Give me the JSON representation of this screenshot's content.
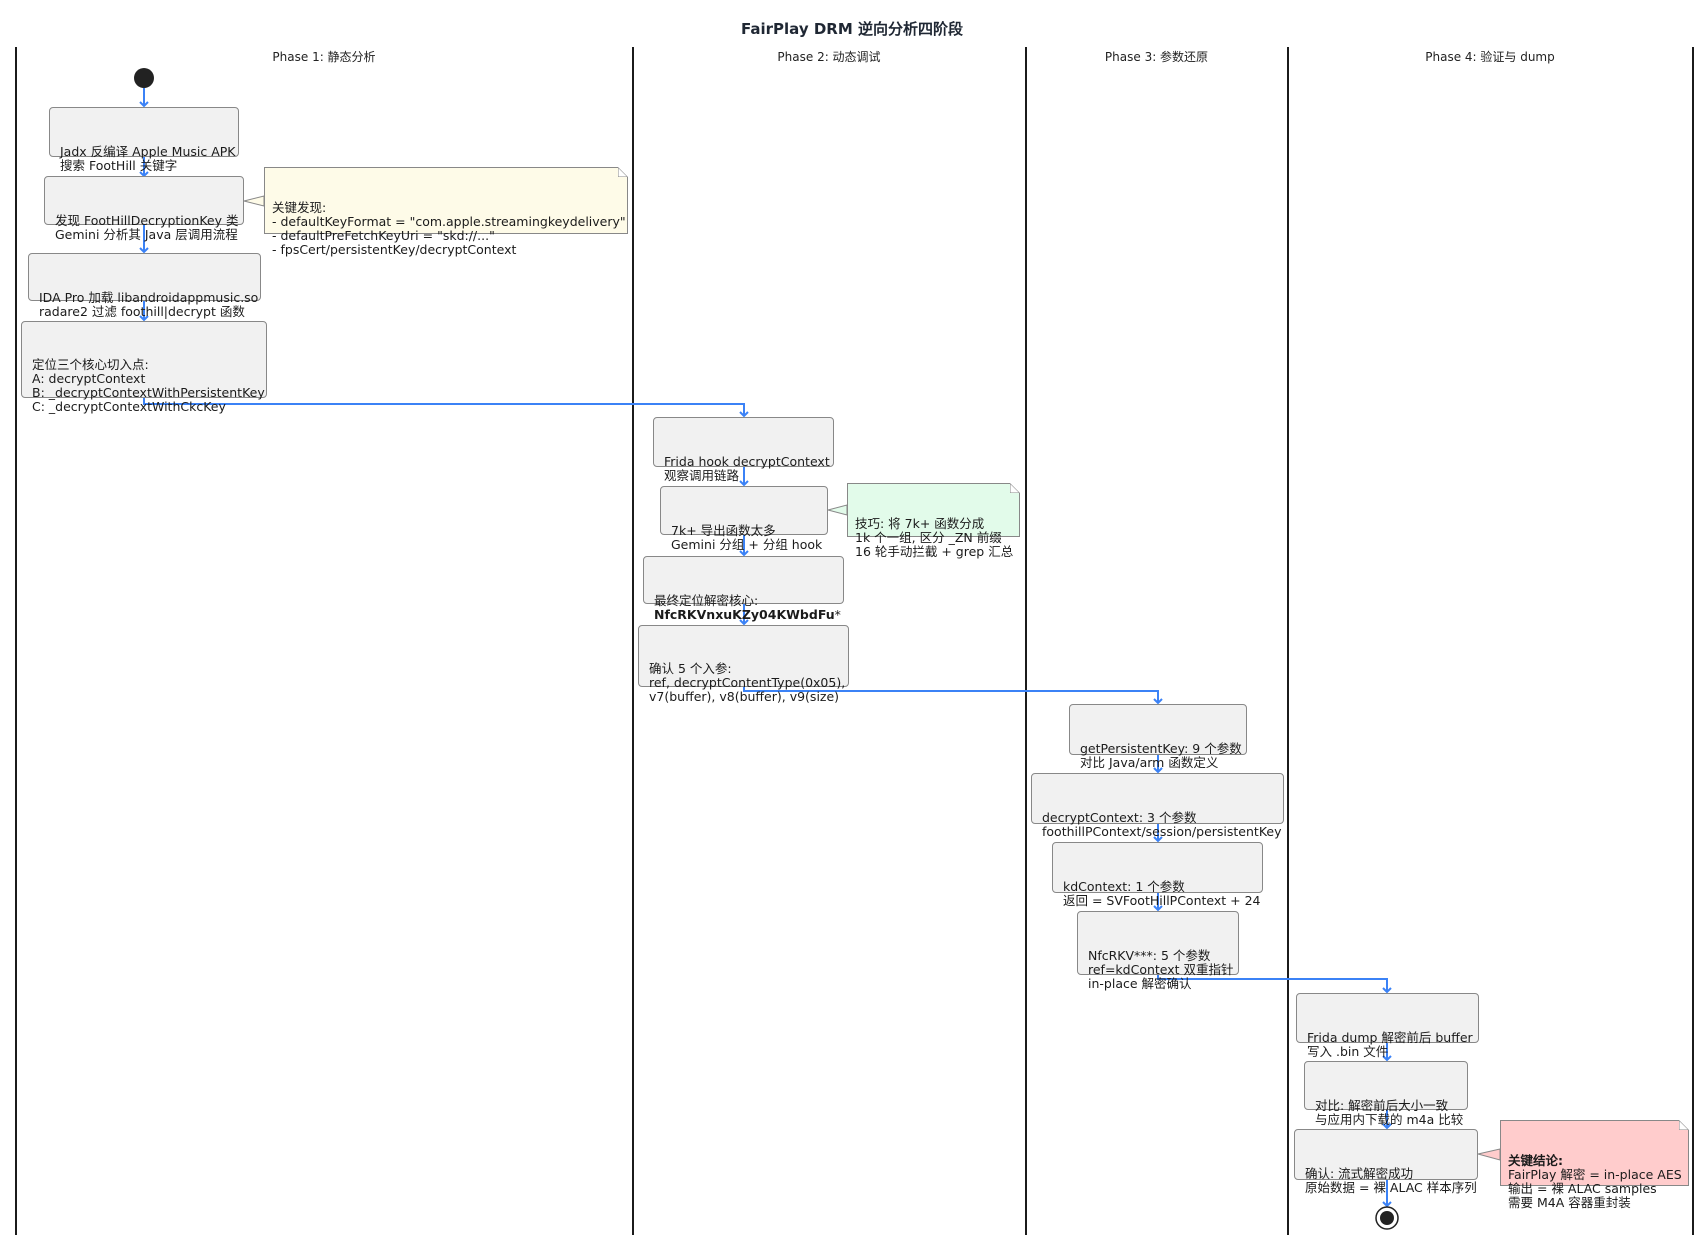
{
  "title": "FairPlay DRM 逆向分析四阶段",
  "lanes": [
    {
      "label": "Phase 1: 静态分析"
    },
    {
      "label": "Phase 2: 动态调试"
    },
    {
      "label": "Phase 3: 参数还原"
    },
    {
      "label": "Phase 4: 验证与 dump"
    }
  ],
  "phase1": {
    "a1": [
      "Jadx 反编译 Apple Music APK",
      "搜索 FootHill 关键字"
    ],
    "a2": [
      "发现 FootHillDecryptionKey 类",
      "Gemini 分析其 Java 层调用流程"
    ],
    "a3": [
      "IDA Pro 加载 libandroidappmusic.so",
      "radare2 过滤 foothill|decrypt 函数"
    ],
    "a4": [
      "定位三个核心切入点:",
      "A: decryptContext",
      "B: _decryptContextWithPersistentKey",
      "C: _decryptContextWithCkcKey"
    ],
    "note": [
      "关键发现:",
      "- defaultKeyFormat = \"com.apple.streamingkeydelivery\"",
      "- defaultPreFetchKeyUri = \"skd://...\"",
      "- fpsCert/persistentKey/decryptContext"
    ]
  },
  "phase2": {
    "a1": [
      "Frida hook decryptContext",
      "观察调用链路"
    ],
    "a2": [
      "7k+ 导出函数太多",
      "Gemini 分组 + 分组 hook"
    ],
    "a3_line1": "最终定位解密核心:",
    "a3_bold": "NfcRKVnxuKZy04KWbdFu",
    "a3_suffix": "*",
    "a4": [
      "确认 5 个入参:",
      "ref, decryptContentType(0x05),",
      "v7(buffer), v8(buffer), v9(size)"
    ],
    "note": [
      "技巧: 将 7k+ 函数分成",
      "1k 个一组, 区分 _ZN 前缀",
      "16 轮手动拦截 + grep 汇总"
    ]
  },
  "phase3": {
    "a1": [
      "getPersistentKey: 9 个参数",
      "对比 Java/arm 函数定义"
    ],
    "a2": [
      "decryptContext: 3 个参数",
      "foothillPContext/session/persistentKey"
    ],
    "a3": [
      "kdContext: 1 个参数",
      "返回 = SVFootHillPContext + 24"
    ],
    "a4": [
      "NfcRKV***: 5 个参数",
      "ref=kdContext 双重指针",
      "in-place 解密确认"
    ]
  },
  "phase4": {
    "a1": [
      "Frida dump 解密前后 buffer",
      "写入 .bin 文件"
    ],
    "a2": [
      "对比: 解密前后大小一致",
      "与应用内下载的 m4a 比较"
    ],
    "a3": [
      "确认: 流式解密成功",
      "原始数据 = 裸 ALAC 样本序列"
    ],
    "note_bold": "关键结论:",
    "note": [
      "FairPlay 解密 = in-place AES",
      "输出 = 裸 ALAC samples",
      "需要 M4A 容器重封装"
    ]
  },
  "colors": {
    "arrow": "#3b82f6",
    "note_yellow": "#fefbe8",
    "note_green": "#e2fbea",
    "note_red": "#ffcccc",
    "box_fill": "#f1f1f1"
  }
}
